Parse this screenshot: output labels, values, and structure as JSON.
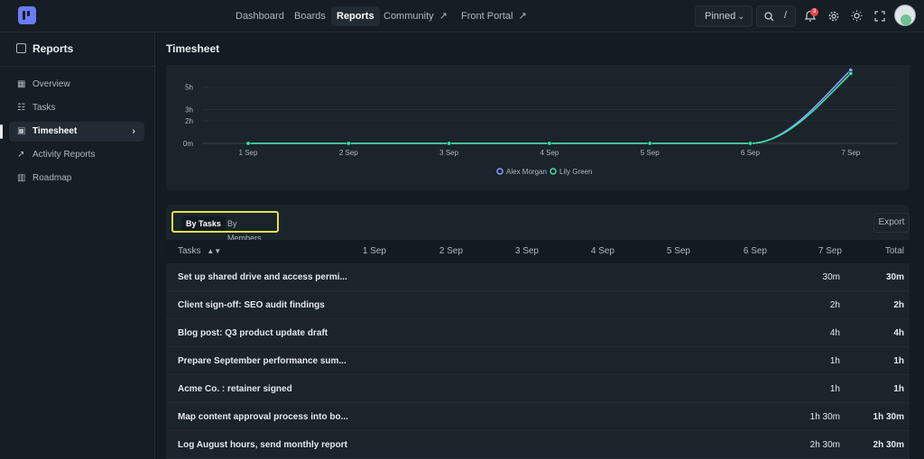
{
  "topbar": {
    "nav": [
      {
        "label": "Dashboard"
      },
      {
        "label": "Boards"
      },
      {
        "label": "Reports"
      },
      {
        "label": "Community",
        "icon": "external-link-icon"
      },
      {
        "label": "Front Portal",
        "icon": "external-link-icon"
      }
    ],
    "pinned_label": "Pinned",
    "search_shortcut": "/",
    "notification_count": "3"
  },
  "sidebar": {
    "title": "Reports",
    "items": [
      {
        "label": "Overview",
        "icon": "grid-icon"
      },
      {
        "label": "Tasks",
        "icon": "checklist-icon"
      },
      {
        "label": "Timesheet",
        "icon": "timesheet-icon"
      },
      {
        "label": "Activity Reports",
        "icon": "line-chart-icon"
      },
      {
        "label": "Roadmap",
        "icon": "map-icon"
      }
    ]
  },
  "page": {
    "title": "Timesheet"
  },
  "chart_data": {
    "type": "line",
    "x": [
      "1 Sep",
      "2 Sep",
      "3 Sep",
      "4 Sep",
      "5 Sep",
      "6 Sep",
      "7 Sep"
    ],
    "y_ticks": [
      "0m",
      "2h",
      "3h",
      "5h"
    ],
    "series": [
      {
        "name": "Alex Morgan",
        "color": "#8e9bff",
        "values_hours": [
          0,
          0,
          0,
          0,
          0,
          0,
          6.5
        ]
      },
      {
        "name": "Lily Green",
        "color": "#3ee0a0",
        "values_hours": [
          0,
          0,
          0,
          0,
          0,
          0,
          6.2
        ]
      }
    ],
    "legend": "bottom-center"
  },
  "table": {
    "tabs": [
      "By Tasks",
      "By Members"
    ],
    "export_label": "Export",
    "headers": [
      "Tasks",
      "1 Sep",
      "2 Sep",
      "3 Sep",
      "4 Sep",
      "5 Sep",
      "6 Sep",
      "7 Sep",
      "Total"
    ],
    "rows": [
      {
        "task": "Set up shared drive and access permi...",
        "sep7": "30m",
        "total": "30m"
      },
      {
        "task": "Client sign-off: SEO audit findings",
        "sep7": "2h",
        "total": "2h"
      },
      {
        "task": "Blog post: Q3 product update draft",
        "sep7": "4h",
        "total": "4h"
      },
      {
        "task": "Prepare September performance sum...",
        "sep7": "1h",
        "total": "1h"
      },
      {
        "task": "Acme Co. : retainer signed",
        "sep7": "1h",
        "total": "1h"
      },
      {
        "task": "Map content approval process into bo...",
        "sep7": "1h 30m",
        "total": "1h 30m"
      },
      {
        "task": "Log August hours, send monthly report",
        "sep7": "2h 30m",
        "total": "2h 30m"
      }
    ]
  }
}
